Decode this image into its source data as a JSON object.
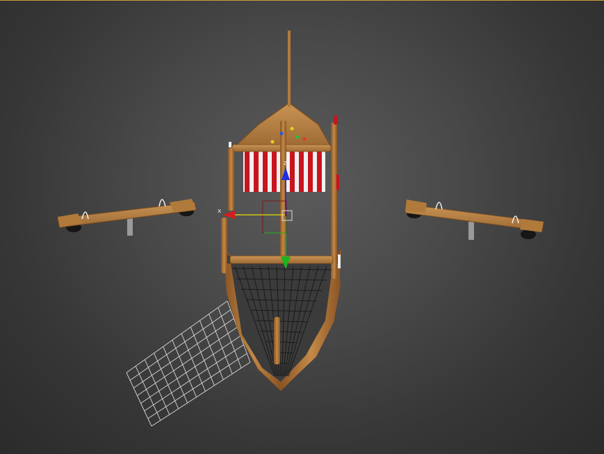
{
  "viewport": {
    "border_color": "#c8a03c",
    "background_center": "#5b5b5b",
    "background_edge": "#2b2b2b"
  },
  "scene": {
    "objects": [
      "playground-ship",
      "seesaw-left",
      "seesaw-right",
      "climbing-net"
    ],
    "wood_color": "#b37a3c",
    "sail_stripe_red": "#c8141e",
    "sail_stripe_white": "#f0f0f0",
    "net_color": "#d8d8d8"
  },
  "gizmo": {
    "x_label": "x",
    "z_label": "z",
    "x_color": "#d21e1e",
    "y_color": "#1eb41e",
    "z_color": "#1e1ed2"
  }
}
